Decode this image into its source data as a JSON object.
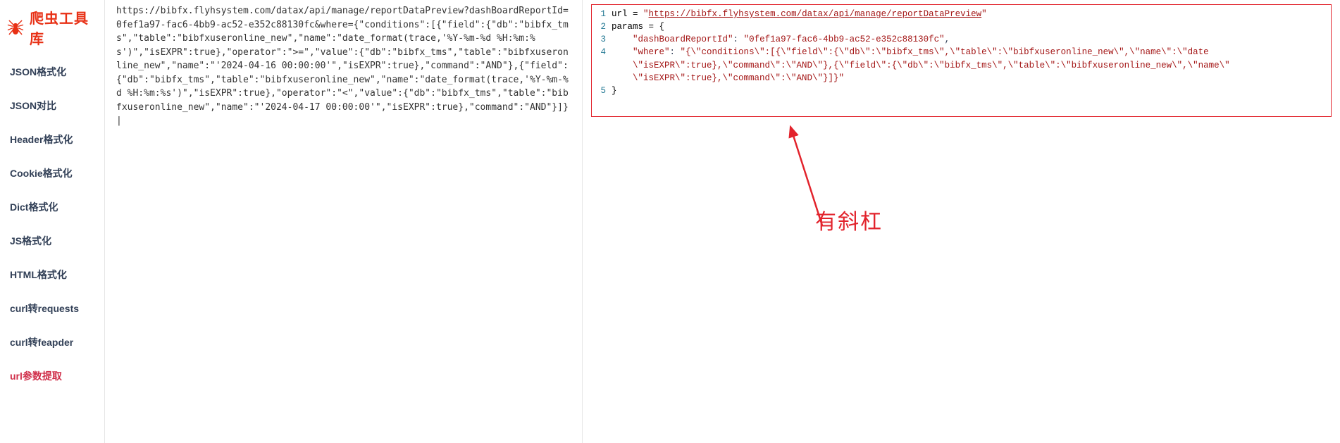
{
  "sidebar": {
    "logo_text": "爬虫工具库",
    "items": [
      {
        "label": "JSON格式化",
        "active": false
      },
      {
        "label": "JSON对比",
        "active": false
      },
      {
        "label": "Header格式化",
        "active": false
      },
      {
        "label": "Cookie格式化",
        "active": false
      },
      {
        "label": "Dict格式化",
        "active": false
      },
      {
        "label": "JS格式化",
        "active": false
      },
      {
        "label": "HTML格式化",
        "active": false
      },
      {
        "label": "curl转requests",
        "active": false
      },
      {
        "label": "curl转feapder",
        "active": false
      },
      {
        "label": "url参数提取",
        "active": true
      }
    ]
  },
  "leftPane": {
    "text": "https://bibfx.flyhsystem.com/datax/api/manage/reportDataPreview?dashBoardReportId=0fef1a97-fac6-4bb9-ac52-e352c88130fc&where={\"conditions\":[{\"field\":{\"db\":\"bibfx_tms\",\"table\":\"bibfxuseronline_new\",\"name\":\"date_format(trace,'%Y-%m-%d %H:%m:%s')\",\"isEXPR\":true},\"operator\":\">=\",\"value\":{\"db\":\"bibfx_tms\",\"table\":\"bibfxuseronline_new\",\"name\":\"'2024-04-16 00:00:00'\",\"isEXPR\":true},\"command\":\"AND\"},{\"field\":{\"db\":\"bibfx_tms\",\"table\":\"bibfxuseronline_new\",\"name\":\"date_format(trace,'%Y-%m-%d %H:%m:%s')\",\"isEXPR\":true},\"operator\":\"<\",\"value\":{\"db\":\"bibfx_tms\",\"table\":\"bibfxuseronline_new\",\"name\":\"'2024-04-17 00:00:00'\",\"isEXPR\":true},\"command\":\"AND\"}]}|"
  },
  "code": {
    "line1_var": "url",
    "line1_eq": " = ",
    "line1_q1": "\"",
    "line1_url": "https://bibfx.flyhsystem.com/datax/api/manage/reportDataPreview",
    "line1_q2": "\"",
    "line2": "params = {",
    "line3_indent": "    ",
    "line3_key": "\"dashBoardReportId\"",
    "line3_sep": ": ",
    "line3_val": "\"0fef1a97-fac6-4bb9-ac52-e352c88130fc\"",
    "line3_comma": ",",
    "line4_indent": "    ",
    "line4_key": "\"where\"",
    "line4_sep": ": ",
    "line4_val_a": "\"{\\\"conditions\\\":[{\\\"field\\\":{\\\"db\\\":\\\"bibfx_tms\\\",\\\"table\\\":\\\"bibfxuseronline_new\\\",\\\"name\\\":\\\"date",
    "line4_val_b": "\\\"isEXPR\\\":true},\\\"command\\\":\\\"AND\\\"},{\\\"field\\\":{\\\"db\\\":\\\"bibfx_tms\\\",\\\"table\\\":\\\"bibfxuseronline_new\\\",\\\"name\\\"",
    "line4_val_c": "\\\"isEXPR\\\":true},\\\"command\\\":\\\"AND\\\"}]}\"",
    "line5": "}"
  },
  "lineNumbers": {
    "n1": "1",
    "n2": "2",
    "n3": "3",
    "n4": "4",
    "n5": "5"
  },
  "annotation": {
    "text": "有斜杠"
  }
}
